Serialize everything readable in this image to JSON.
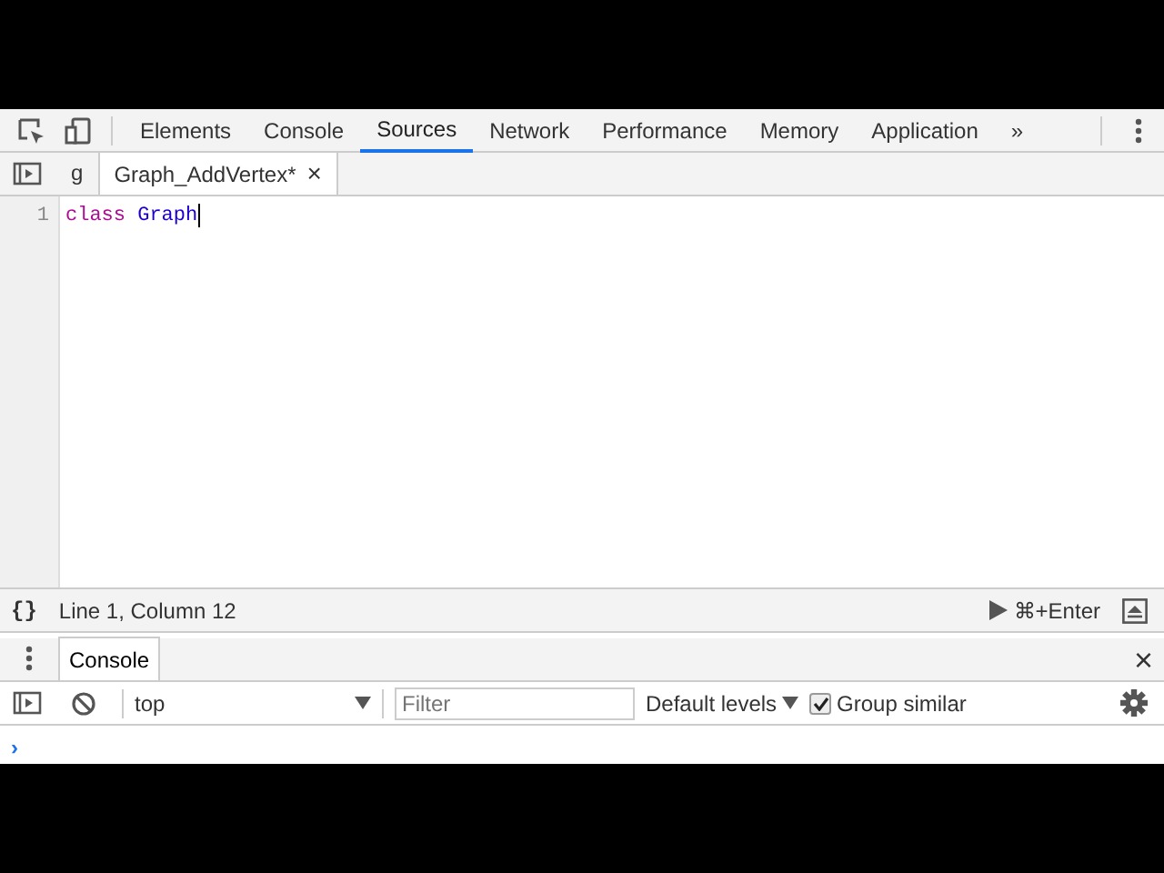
{
  "main_tabs": [
    {
      "label": "Elements",
      "selected": false
    },
    {
      "label": "Console",
      "selected": false
    },
    {
      "label": "Sources",
      "selected": true
    },
    {
      "label": "Network",
      "selected": false
    },
    {
      "label": "Performance",
      "selected": false
    },
    {
      "label": "Memory",
      "selected": false
    },
    {
      "label": "Application",
      "selected": false
    }
  ],
  "more_tabs": "»",
  "file_tabs": [
    {
      "label": "g",
      "selected": false,
      "closable": false
    },
    {
      "label": "Graph_AddVertex*",
      "selected": true,
      "closable": true
    }
  ],
  "close_glyph": "×",
  "editor": {
    "lines": [
      {
        "number": "1",
        "tokens": [
          {
            "text": "class",
            "kind": "keyword"
          },
          {
            "text": "Graph",
            "kind": "name"
          }
        ]
      }
    ]
  },
  "status_bar": {
    "format_glyph": "{}",
    "position": "Line 1, Column 12",
    "run_shortcut": "⌘+Enter"
  },
  "drawer": {
    "tabs": [
      {
        "label": "Console",
        "selected": true
      }
    ],
    "close_glyph": "×"
  },
  "console_toolbar": {
    "context": "top",
    "filter_placeholder": "Filter",
    "levels": "Default levels",
    "group_similar": {
      "label": "Group similar",
      "checked": true
    }
  },
  "console": {
    "prompt": "›"
  }
}
